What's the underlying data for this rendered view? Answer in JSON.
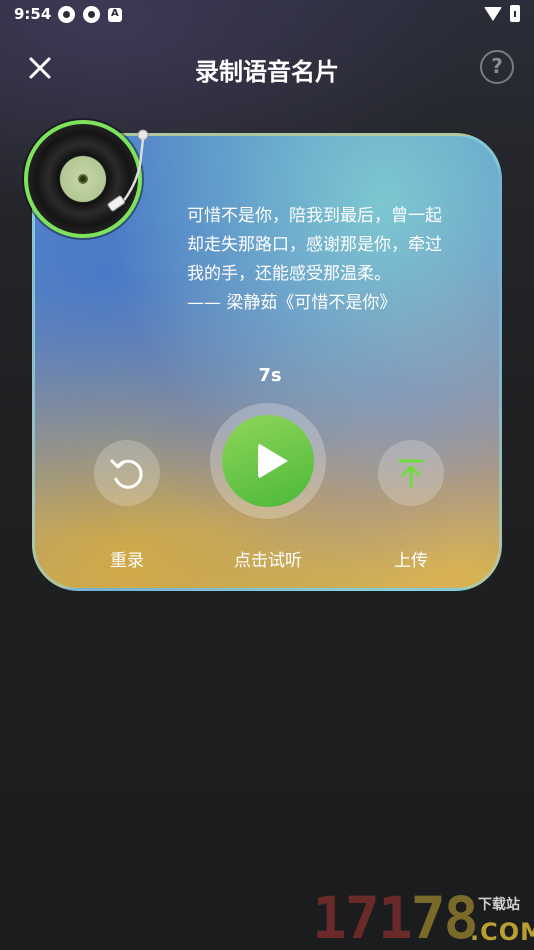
{
  "status_bar": {
    "time": "9:54",
    "icons": [
      "app-notification-icon",
      "app-notification-icon",
      "a-icon",
      "wifi-icon",
      "battery-charging-icon"
    ]
  },
  "header": {
    "title": "录制语音名片",
    "close_icon": "close-icon",
    "help_symbol": "?"
  },
  "card": {
    "lyrics": [
      "可惜不是你，陪我到最后，曾一起",
      "却走失那路口，感谢那是你，牵过",
      "我的手，还能感受那温柔。",
      "—— 梁静茹《可惜不是你》"
    ],
    "timer": "7s",
    "controls": {
      "redo_label": "重录",
      "play_label": "点击试听",
      "upload_label": "上传"
    }
  },
  "watermark": {
    "digits_a": "171",
    "digits_b": "78",
    "site": "下载站",
    "domain": ".COM"
  },
  "colors": {
    "accent_green": "#5dc43f",
    "upload_icon_green": "#6fdc3c",
    "vinyl_ring": "#7ee25a"
  }
}
